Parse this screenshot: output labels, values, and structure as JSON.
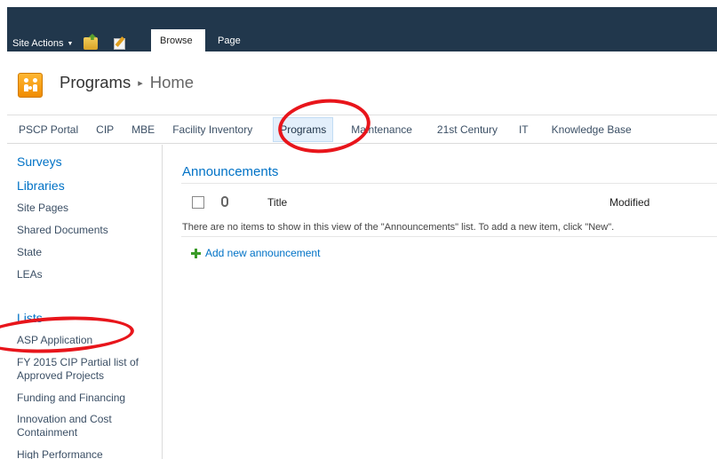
{
  "ribbon": {
    "site_actions": "Site Actions",
    "tabs": [
      {
        "label": "Browse"
      },
      {
        "label": "Page"
      }
    ]
  },
  "title_area": {
    "site_title": "Programs",
    "separator": "▸",
    "page_title": "Home"
  },
  "top_nav": {
    "items": [
      {
        "label": "PSCP Portal"
      },
      {
        "label": "CIP"
      },
      {
        "label": "MBE"
      },
      {
        "label": "Facility Inventory"
      },
      {
        "label": "Programs"
      },
      {
        "label": "Maintenance"
      },
      {
        "label": "21st Century"
      },
      {
        "label": "IT"
      },
      {
        "label": "Knowledge Base"
      }
    ],
    "selected": "Programs"
  },
  "quick_launch": {
    "surveys": "Surveys",
    "libraries": "Libraries",
    "library_items": [
      "Site Pages",
      "Shared Documents",
      "State",
      "LEAs"
    ],
    "lists": "Lists",
    "list_items": [
      "ASP Application",
      "FY 2015 CIP Partial list of Approved Projects",
      "Funding and Financing",
      "Innovation and Cost Containment",
      "High Performance"
    ]
  },
  "announcements": {
    "title": "Announcements",
    "columns": {
      "title": "Title",
      "modified": "Modified"
    },
    "empty_message": "There are no items to show in this view of the \"Announcements\" list. To add a new item, click \"New\".",
    "add_new": "Add new announcement"
  },
  "colors": {
    "ribbon": "#21374c",
    "link": "#0072c6",
    "annotation": "#e8151b"
  }
}
